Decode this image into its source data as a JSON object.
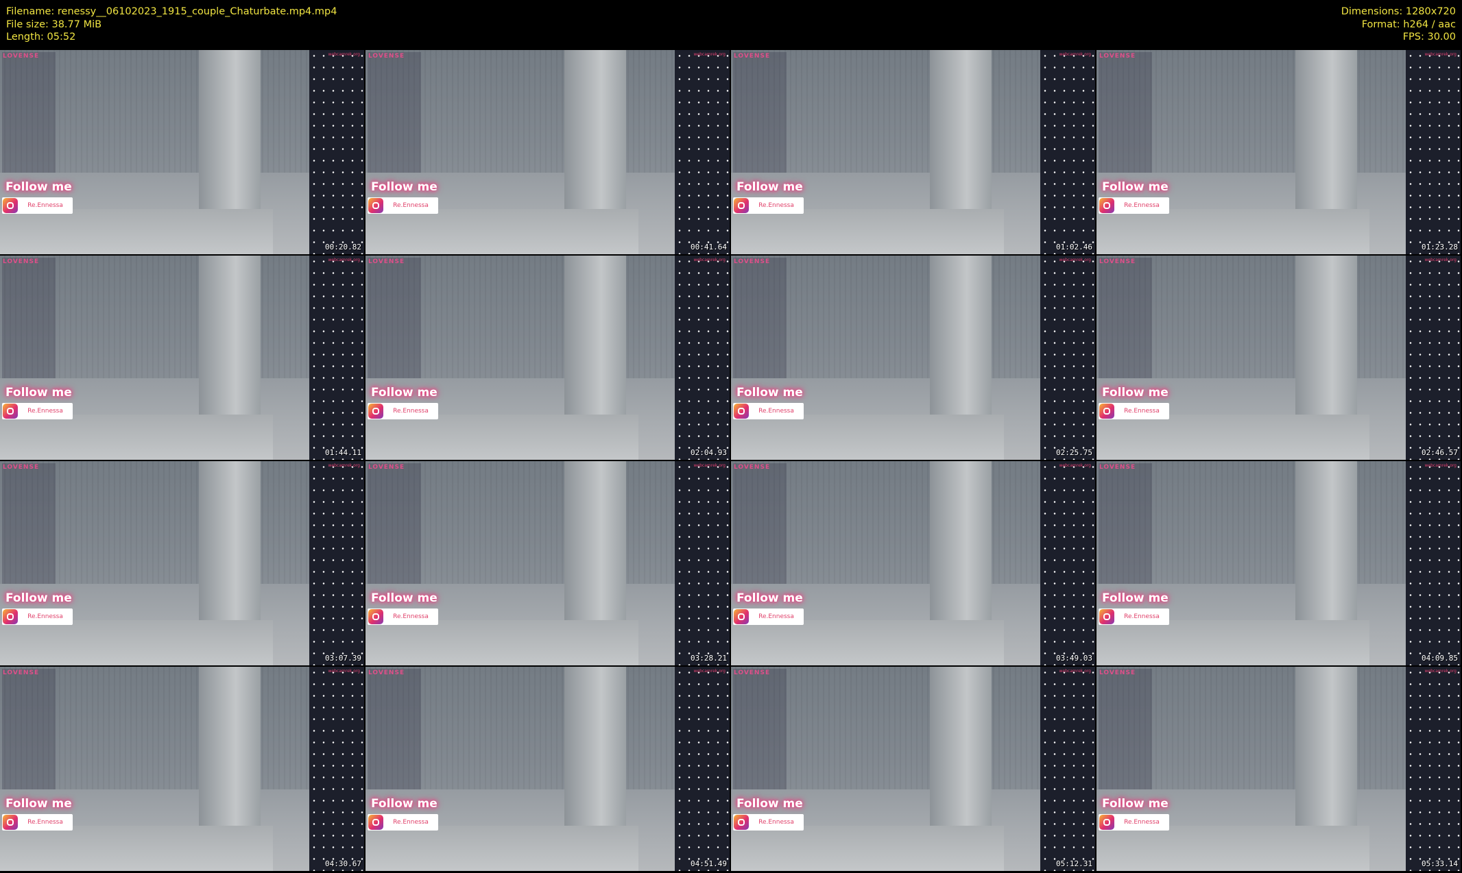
{
  "meta": {
    "filename": "Filename: renessy__06102023_1915_couple_Chaturbate.mp4.mp4",
    "filesize": "File size: 38.77 MiB",
    "length": "Length: 05:52",
    "dimensions": "Dimensions: 1280x720",
    "format": "Format: h264 / aac",
    "fps": "FPS: 30.00"
  },
  "overlay": {
    "brand": "LOVENSE",
    "site": "webcamrek.org",
    "follow": "Follow me",
    "instagram_handle": "Re.Ennessa"
  },
  "thumbnails": [
    {
      "timestamp": "00:20.82"
    },
    {
      "timestamp": "00:41.64"
    },
    {
      "timestamp": "01:02.46"
    },
    {
      "timestamp": "01:23.28"
    },
    {
      "timestamp": "01:44.11"
    },
    {
      "timestamp": "02:04.93"
    },
    {
      "timestamp": "02:25.75"
    },
    {
      "timestamp": "02:46.57"
    },
    {
      "timestamp": "03:07.39"
    },
    {
      "timestamp": "03:28.21"
    },
    {
      "timestamp": "03:49.03"
    },
    {
      "timestamp": "04:09.85"
    },
    {
      "timestamp": "04:30.67"
    },
    {
      "timestamp": "04:51.49"
    },
    {
      "timestamp": "05:12.31"
    },
    {
      "timestamp": "05:33.14"
    }
  ]
}
